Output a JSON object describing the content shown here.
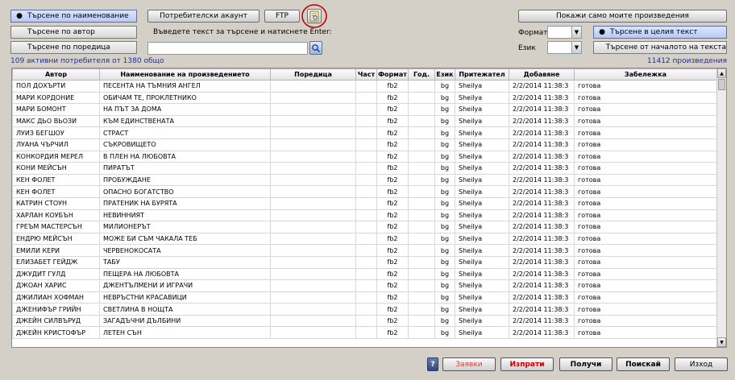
{
  "search_modes": {
    "by_title": "Търсене по наименование",
    "by_author": "Търсене по автор",
    "by_series": "Търсене по поредица"
  },
  "toolbar": {
    "user_account": "Потребителски акаунт",
    "ftp": "FTP",
    "show_mine": "Покажи само моите произведения"
  },
  "search": {
    "prompt": "Въведете текст за търсене и натиснете Enter:",
    "value": ""
  },
  "filters": {
    "format_label": "Формат",
    "format_value": "",
    "language_label": "Език",
    "language_value": "",
    "search_whole": "Търсене в целия текст",
    "search_start": "Търсене от началото на текста"
  },
  "status": {
    "active_users": "109 активни потребителя от 1380 общо",
    "works_count": "11412 произведения"
  },
  "table": {
    "headers": [
      "Автор",
      "Наименование на произведението",
      "Поредица",
      "Част",
      "Формат",
      "Год.",
      "Език",
      "Притежател",
      "Добавяне",
      "Забележка"
    ],
    "rows": [
      [
        "ПОЛ ДОХЪРТИ",
        "ПЕСЕНТА НА ТЪМНИЯ АНГЕЛ",
        "",
        "",
        "fb2",
        "",
        "bg",
        "Sheilya",
        "2/2/2014 11:38:3",
        "готова"
      ],
      [
        "МАРИ КОРДОНИЕ",
        "ОБИЧАМ ТЕ, ПРОКЛЕТНИКО",
        "",
        "",
        "fb2",
        "",
        "bg",
        "Sheilya",
        "2/2/2014 11:38:3",
        "готова"
      ],
      [
        "МАРИ БОМОНТ",
        "НА ПЪТ ЗА ДОМА",
        "",
        "",
        "fb2",
        "",
        "bg",
        "Sheilya",
        "2/2/2014 11:38:3",
        "готова"
      ],
      [
        "МАКС ДЬО ВЬОЗИ",
        "КЪМ ЕДИНСТВЕНАТА",
        "",
        "",
        "fb2",
        "",
        "bg",
        "Sheilya",
        "2/2/2014 11:38:3",
        "готова"
      ],
      [
        "ЛУИЗ БЕГШОУ",
        "СТРАСТ",
        "",
        "",
        "fb2",
        "",
        "bg",
        "Sheilya",
        "2/2/2014 11:38:3",
        "готова"
      ],
      [
        "ЛУАНА ЧЪРЧИЛ",
        "СЪКРОВИЩЕТО",
        "",
        "",
        "fb2",
        "",
        "bg",
        "Sheilya",
        "2/2/2014 11:38:3",
        "готова"
      ],
      [
        "КОНКОРДИЯ МЕРЕЛ",
        "В ПЛЕН НА ЛЮБОВТА",
        "",
        "",
        "fb2",
        "",
        "bg",
        "Sheilya",
        "2/2/2014 11:38:3",
        "готова"
      ],
      [
        "КОНИ МЕЙСЪН",
        "ПИРАТЪТ",
        "",
        "",
        "fb2",
        "",
        "bg",
        "Sheilya",
        "2/2/2014 11:38:3",
        "готова"
      ],
      [
        "КЕН ФОЛЕТ",
        "ПРОБУЖДАНЕ",
        "",
        "",
        "fb2",
        "",
        "bg",
        "Sheilya",
        "2/2/2014 11:38:3",
        "готова"
      ],
      [
        "КЕН ФОЛЕТ",
        "ОПАСНО БОГАТСТВО",
        "",
        "",
        "fb2",
        "",
        "bg",
        "Sheilya",
        "2/2/2014 11:38:3",
        "готова"
      ],
      [
        "КАТРИН СТОУН",
        "ПРАТЕНИК НА БУРЯТА",
        "",
        "",
        "fb2",
        "",
        "bg",
        "Sheilya",
        "2/2/2014 11:38:3",
        "готова"
      ],
      [
        "ХАРЛАН КОУБЪН",
        "НЕВИННИЯТ",
        "",
        "",
        "fb2",
        "",
        "bg",
        "Sheilya",
        "2/2/2014 11:38:3",
        "готова"
      ],
      [
        "ГРЕЪМ МАСТЕРСЪН",
        "МИЛИОНЕРЪТ",
        "",
        "",
        "fb2",
        "",
        "bg",
        "Sheilya",
        "2/2/2014 11:38:3",
        "готова"
      ],
      [
        "ЕНДРЮ МЕЙСЪН",
        "МОЖЕ БИ СЪМ ЧАКАЛА ТЕБ",
        "",
        "",
        "fb2",
        "",
        "bg",
        "Sheilya",
        "2/2/2014 11:38:3",
        "готова"
      ],
      [
        "ЕМИЛИ КЕРИ",
        "ЧЕРВЕНОКОСАТА",
        "",
        "",
        "fb2",
        "",
        "bg",
        "Sheilya",
        "2/2/2014 11:38:3",
        "готова"
      ],
      [
        "ЕЛИЗАБЕТ ГЕЙДЖ",
        "ТАБУ",
        "",
        "",
        "fb2",
        "",
        "bg",
        "Sheilya",
        "2/2/2014 11:38:3",
        "готова"
      ],
      [
        "ДЖУДИТ ГУЛД",
        "ПЕЩЕРА НА ЛЮБОВТА",
        "",
        "",
        "fb2",
        "",
        "bg",
        "Sheilya",
        "2/2/2014 11:38:3",
        "готова"
      ],
      [
        "ДЖОАН ХАРИС",
        "ДЖЕНТЪЛМЕНИ И ИГРАЧИ",
        "",
        "",
        "fb2",
        "",
        "bg",
        "Sheilya",
        "2/2/2014 11:38:3",
        "готова"
      ],
      [
        "ДЖИЛИАН ХОФМАН",
        "НЕВРЪСТНИ КРАСАВИЦИ",
        "",
        "",
        "fb2",
        "",
        "bg",
        "Sheilya",
        "2/2/2014 11:38:3",
        "готова"
      ],
      [
        "ДЖЕНИФЪР ГРИЙН",
        "СВЕТЛИНА В НОЩТА",
        "",
        "",
        "fb2",
        "",
        "bg",
        "Sheilya",
        "2/2/2014 11:38:3",
        "готова"
      ],
      [
        "ДЖЕЙН СИЛВЪРУД",
        "ЗАГАДЪЧНИ ДЪЛБИНИ",
        "",
        "",
        "fb2",
        "",
        "bg",
        "Sheilya",
        "2/2/2014 11:38:3",
        "готова"
      ],
      [
        "ДЖЕЙН КРИСТОФЪР",
        "ЛЕТЕН СЪН",
        "",
        "",
        "fb2",
        "",
        "bg",
        "Sheilya",
        "2/2/2014 11:38:3",
        "готова"
      ]
    ]
  },
  "bottom": {
    "help": "?",
    "requests": "Заявки",
    "send": "Изпрати",
    "receive": "Получи",
    "search": "Поискай",
    "exit": "Изход"
  },
  "colors": {
    "selected_mode": "#b6c8f5",
    "status_text": "#1a2fb0",
    "red_buttons": "#c00000",
    "highlight_circle": "#c00000"
  },
  "icons": {
    "ftp_browse": "folder-search-icon",
    "search_go": "magnifier-icon",
    "help": "question-icon"
  }
}
